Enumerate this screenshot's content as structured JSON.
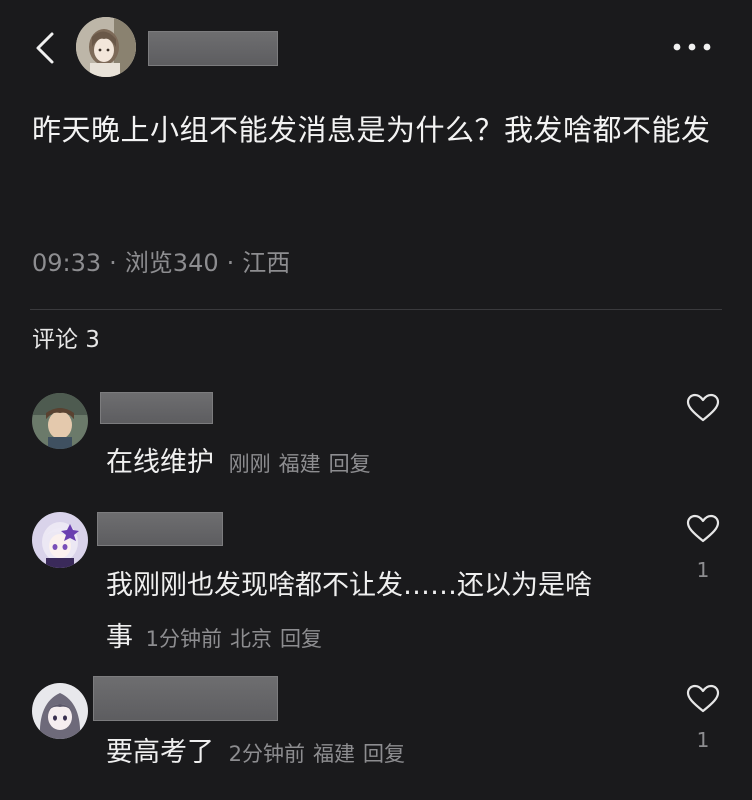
{
  "header": {
    "back_icon": "chevron-left-icon",
    "more_icon": "more-horizontal-icon"
  },
  "post": {
    "text": "昨天晚上小组不能发消息是为什么？我发啥都不能发",
    "time": "09:33",
    "views": "浏览340",
    "location": "江西",
    "separator": "·"
  },
  "comments_section": {
    "title": "评论 3",
    "items": [
      {
        "text": "在线维护",
        "time": "刚刚",
        "location": "福建",
        "reply": "回复",
        "likes": ""
      },
      {
        "text_line1": "我刚刚也发现啥都不让发……还以为是啥",
        "text_line2": "事",
        "time": "1分钟前",
        "location": "北京",
        "reply": "回复",
        "likes": "1"
      },
      {
        "text": "要高考了",
        "time": "2分钟前",
        "location": "福建",
        "reply": "回复",
        "likes": "1"
      }
    ]
  },
  "colors": {
    "background": "#1a1a1c",
    "primary_text": "#f2f2f2",
    "secondary_text": "#8d8d90",
    "redaction": "#6a6a6c"
  }
}
